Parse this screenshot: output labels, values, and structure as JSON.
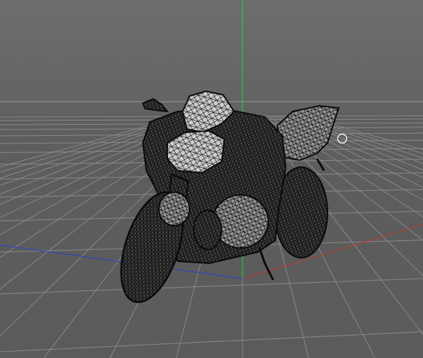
{
  "viewport": {
    "view": "perspective",
    "display_mode": "wireframe",
    "background_color": "#5e5e5e",
    "grid": true,
    "grid_color": "#8a8a8a",
    "axis_colors": {
      "x": "#c0392b",
      "y": "#2ecc40",
      "z": "#2244cc"
    },
    "model": {
      "name": "motorcycle",
      "mesh_color": "#111111"
    },
    "cursor_icon": "circle-cursor-icon"
  }
}
